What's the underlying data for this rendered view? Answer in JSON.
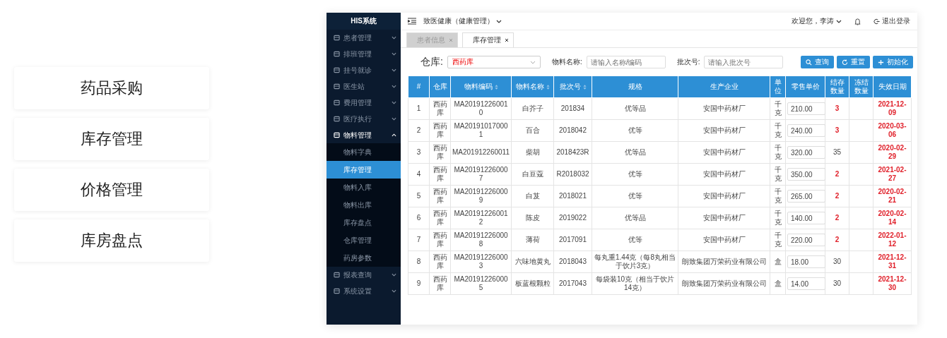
{
  "feature_cards": [
    {
      "label": "药品采购"
    },
    {
      "label": "库存管理"
    },
    {
      "label": "价格管理"
    },
    {
      "label": "库房盘点"
    }
  ],
  "app": {
    "sidebar": {
      "title": "HIS系统",
      "items": [
        {
          "label": "患者管理",
          "expanded": false
        },
        {
          "label": "排班管理",
          "expanded": false
        },
        {
          "label": "挂号就诊",
          "expanded": false
        },
        {
          "label": "医生站",
          "expanded": false
        },
        {
          "label": "费用管理",
          "expanded": false
        },
        {
          "label": "医疗执行",
          "expanded": false
        },
        {
          "label": "物料管理",
          "expanded": true,
          "children": [
            {
              "label": "物料字典",
              "selected": false
            },
            {
              "label": "库存管理",
              "selected": true
            },
            {
              "label": "物料入库",
              "selected": false
            },
            {
              "label": "物料出库",
              "selected": false
            },
            {
              "label": "库存盘点",
              "selected": false
            },
            {
              "label": "仓库管理",
              "selected": false
            },
            {
              "label": "药房参数",
              "selected": false
            }
          ]
        },
        {
          "label": "报表查询",
          "expanded": false
        },
        {
          "label": "系统设置",
          "expanded": false
        }
      ]
    },
    "header": {
      "org": "致医健康（健康管理）",
      "user": "欢迎您，李涛",
      "logout": "退出登录"
    },
    "tabs": [
      {
        "label": "患者信息",
        "selected": false
      },
      {
        "label": "库存管理",
        "selected": true
      }
    ],
    "filters": {
      "warehouse_label": "仓库:",
      "warehouse_value": "西药库",
      "name_label": "物料名称:",
      "name_placeholder": "请输入名称/编码",
      "batch_label": "批次号:",
      "batch_placeholder": "请输入批次号"
    },
    "buttons": [
      {
        "label": "查询",
        "kind": "search"
      },
      {
        "label": "重置",
        "kind": "reset"
      },
      {
        "label": "初始化",
        "kind": "add"
      }
    ],
    "table": {
      "columns": [
        {
          "label": "#",
          "sortable": false
        },
        {
          "label": "仓库",
          "sortable": false
        },
        {
          "label": "物料编码",
          "sortable": true
        },
        {
          "label": "物料名称",
          "sortable": true
        },
        {
          "label": "批次号",
          "sortable": true
        },
        {
          "label": "规格",
          "sortable": false
        },
        {
          "label": "生产企业",
          "sortable": false
        },
        {
          "label": "单位",
          "sortable": false
        },
        {
          "label": "零售单价",
          "sortable": false
        },
        {
          "label": "结存数量",
          "sortable": false
        },
        {
          "label": "冻结数量",
          "sortable": false
        },
        {
          "label": "失效日期",
          "sortable": false
        }
      ],
      "rows": [
        {
          "no": "1",
          "warehouse": "西药库",
          "code": "MA201912260010",
          "name": "白芥子",
          "batch": "201834",
          "spec": "优等品",
          "maker": "安国中药材厂",
          "unit": "千克",
          "price": "210.00",
          "stock": "3",
          "low_stock": true,
          "expiry": "2021-12-09"
        },
        {
          "no": "2",
          "warehouse": "西药库",
          "code": "MA201910170001",
          "name": "百合",
          "batch": "2018042",
          "spec": "优等",
          "maker": "安国中药材厂",
          "unit": "千克",
          "price": "240.00",
          "stock": "3",
          "low_stock": true,
          "expiry": "2020-03-06"
        },
        {
          "no": "3",
          "warehouse": "西药库",
          "code": "MA201912260011",
          "name": "柴胡",
          "batch": "2018423R",
          "spec": "优等品",
          "maker": "安国中药材厂",
          "unit": "千克",
          "price": "320.00",
          "stock": "35",
          "low_stock": false,
          "expiry": "2020-02-29"
        },
        {
          "no": "4",
          "warehouse": "西药库",
          "code": "MA201912260007",
          "name": "白豆蔻",
          "batch": "R2018032",
          "spec": "优等",
          "maker": "安国中药材厂",
          "unit": "千克",
          "price": "350.00",
          "stock": "2",
          "low_stock": true,
          "expiry": "2021-02-27"
        },
        {
          "no": "5",
          "warehouse": "西药库",
          "code": "MA201912260009",
          "name": "白芨",
          "batch": "2018021",
          "spec": "优等",
          "maker": "安国中药材厂",
          "unit": "千克",
          "price": "265.00",
          "stock": "2",
          "low_stock": true,
          "expiry": "2020-02-21"
        },
        {
          "no": "6",
          "warehouse": "西药库",
          "code": "MA201912260012",
          "name": "陈皮",
          "batch": "2019022",
          "spec": "优等品",
          "maker": "安国中药材厂",
          "unit": "千克",
          "price": "140.00",
          "stock": "2",
          "low_stock": true,
          "expiry": "2020-02-14"
        },
        {
          "no": "7",
          "warehouse": "西药库",
          "code": "MA201912260008",
          "name": "薄荷",
          "batch": "2017091",
          "spec": "优等",
          "maker": "安国中药材厂",
          "unit": "千克",
          "price": "220.00",
          "stock": "2",
          "low_stock": true,
          "expiry": "2022-01-12"
        },
        {
          "no": "8",
          "warehouse": "西药库",
          "code": "MA201912260003",
          "name": "六味地黄丸",
          "batch": "2018043",
          "spec": "每丸重1.44克（每8丸相当于饮片3克）",
          "maker": "朗致集团万荣药业有限公司",
          "unit": "盒",
          "price": "18.00",
          "stock": "30",
          "low_stock": false,
          "expiry": "2021-12-31"
        },
        {
          "no": "9",
          "warehouse": "西药库",
          "code": "MA201912260005",
          "name": "板蓝根颗粒",
          "batch": "2017043",
          "spec": "每袋装10克（相当于饮片14克）",
          "maker": "朗致集团万荣药业有限公司",
          "unit": "盒",
          "price": "14.00",
          "stock": "30",
          "low_stock": false,
          "expiry": "2021-12-30"
        }
      ]
    }
  }
}
